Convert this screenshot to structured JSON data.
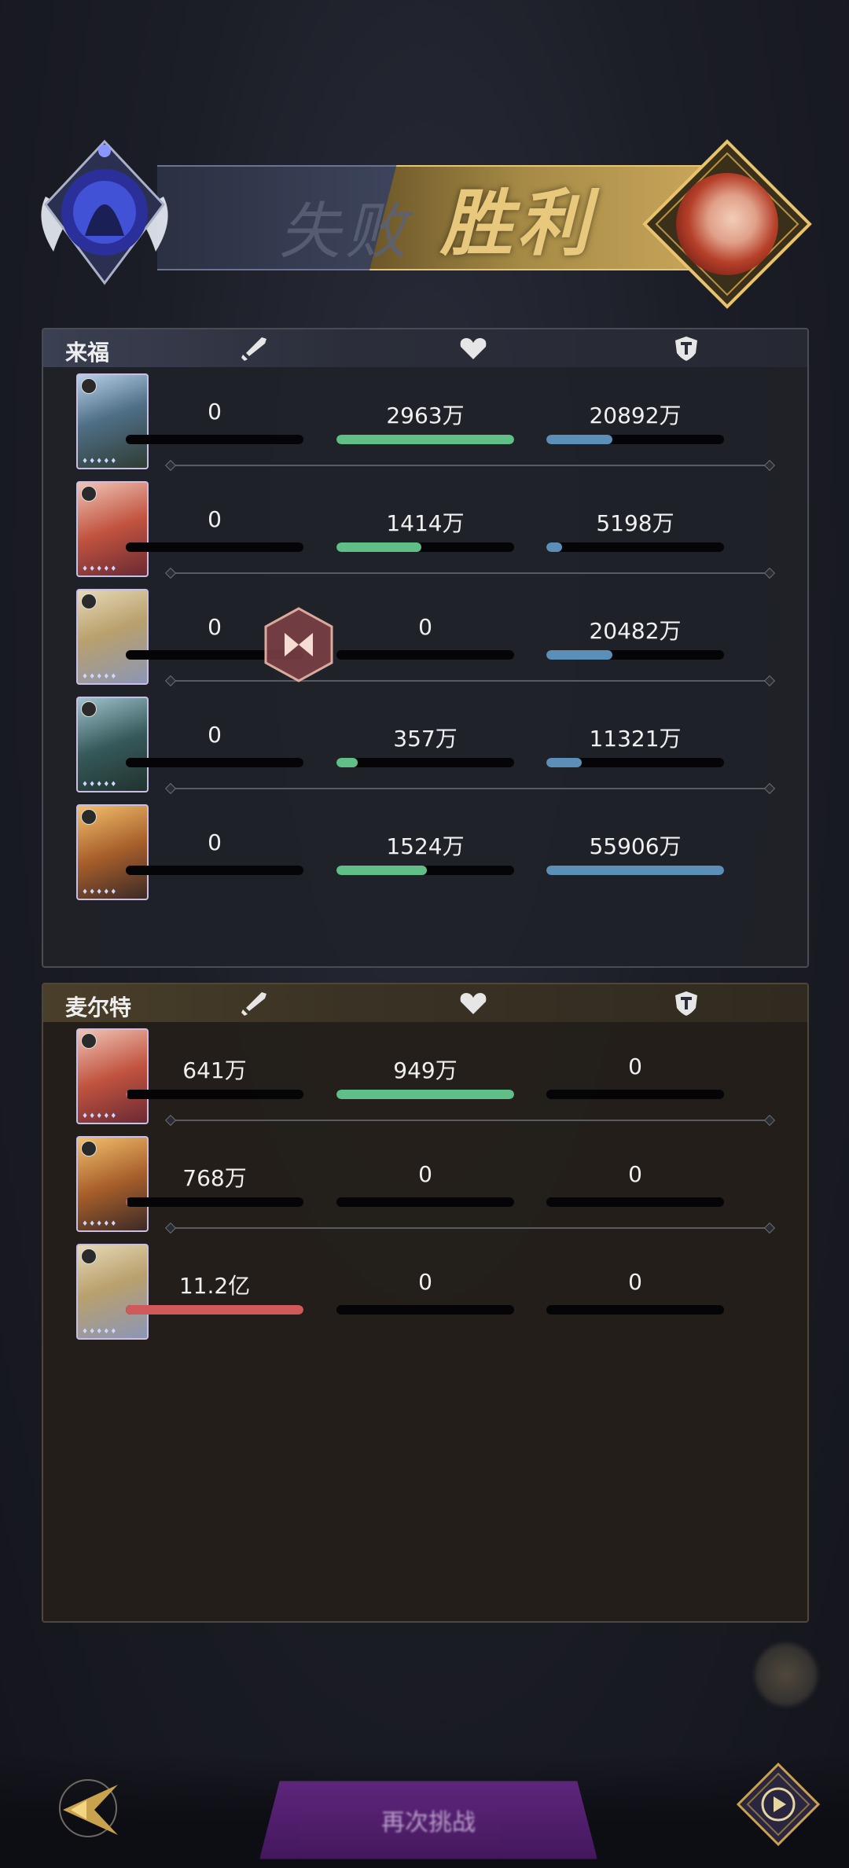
{
  "banner": {
    "lose_label": "失败",
    "win_label": "胜利"
  },
  "colors": {
    "heal": "#5fbf86",
    "shield": "#5b8fb8",
    "damage": "#d05a5a"
  },
  "team1": {
    "name": "来福",
    "rows": [
      {
        "damage": "0",
        "heal": "2963万",
        "shield": "20892万",
        "heal_pct": 100,
        "shield_pct": 37,
        "damage_pct": 0
      },
      {
        "damage": "0",
        "heal": "1414万",
        "shield": "5198万",
        "heal_pct": 48,
        "shield_pct": 9,
        "damage_pct": 0
      },
      {
        "damage": "0",
        "heal": "0",
        "shield": "20482万",
        "heal_pct": 0,
        "shield_pct": 37,
        "damage_pct": 0
      },
      {
        "damage": "0",
        "heal": "357万",
        "shield": "11321万",
        "heal_pct": 12,
        "shield_pct": 20,
        "damage_pct": 0
      },
      {
        "damage": "0",
        "heal": "1524万",
        "shield": "55906万",
        "heal_pct": 51,
        "shield_pct": 100,
        "damage_pct": 0
      }
    ]
  },
  "team2": {
    "name": "麦尔特",
    "rows": [
      {
        "damage": "641万",
        "heal": "949万",
        "shield": "0",
        "damage_pct": 1,
        "heal_pct": 100,
        "shield_pct": 0
      },
      {
        "damage": "768万",
        "heal": "0",
        "shield": "0",
        "damage_pct": 1,
        "heal_pct": 0,
        "shield_pct": 0
      },
      {
        "damage": "11.2亿",
        "heal": "0",
        "shield": "0",
        "damage_pct": 100,
        "heal_pct": 0,
        "shield_pct": 0
      }
    ]
  },
  "icons": {
    "damage": "sword-icon",
    "heal": "heart-icon",
    "shield": "shield-icon",
    "back": "back-arrow-icon",
    "replay": "replay-icon"
  },
  "bottom": {
    "middle_button_label": "再次挑战"
  }
}
